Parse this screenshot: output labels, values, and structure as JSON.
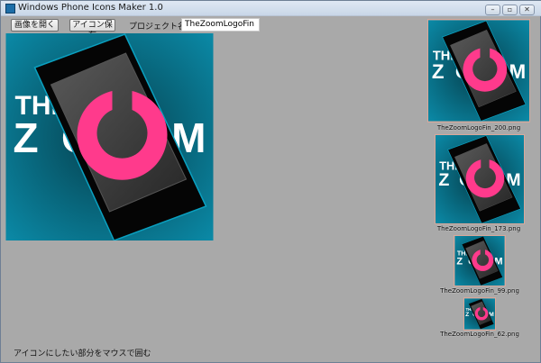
{
  "window": {
    "title": "Windows Phone Icons Maker 1.0",
    "controls": [
      "minimize",
      "maximize",
      "close"
    ]
  },
  "toolbar": {
    "open_image": "画像を開く",
    "save_icons": "アイコン保存",
    "project_name_label": "プロジェクト名",
    "project_name_value": "TheZoomLogoFin"
  },
  "logo": {
    "line1": "THE",
    "line2": "ZOOM"
  },
  "icons": [
    {
      "label": "TheZoomLogoFin_200.png"
    },
    {
      "label": "TheZoomLogoFin_173.png"
    },
    {
      "label": "TheZoomLogoFin_99.png"
    },
    {
      "label": "TheZoomLogoFin_62.png"
    }
  ],
  "status": {
    "hint": "アイコンにしたい部分をマウスで囲む"
  },
  "colors": {
    "teal": "#0a6f86",
    "pink": "#ff3a8c",
    "phone": "#2f2f2f"
  }
}
